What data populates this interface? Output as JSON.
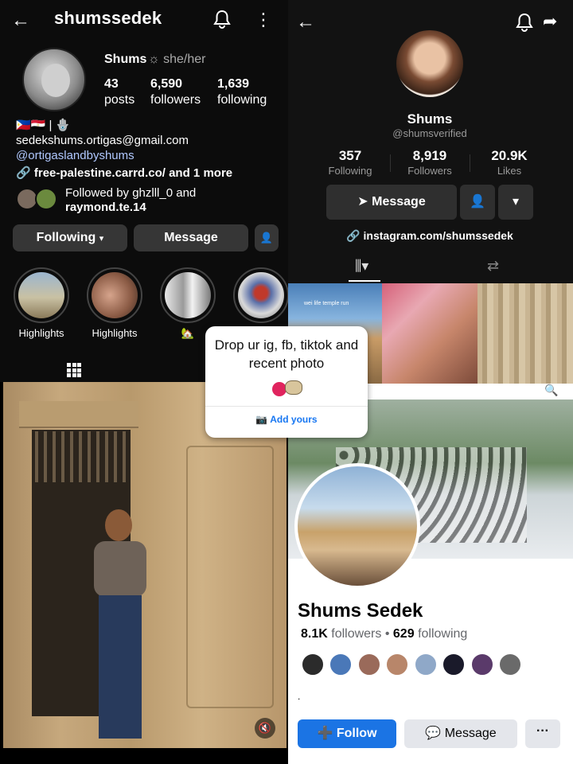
{
  "instagram": {
    "username": "shumssedek",
    "display_name": "Shums",
    "pronouns": "she/her",
    "stats": [
      {
        "number": "43",
        "label": "posts"
      },
      {
        "number": "6,590",
        "label": "followers"
      },
      {
        "number": "1,639",
        "label": "following"
      }
    ],
    "bio_flags": "🇵🇭🇪🇬 | 🪬",
    "email": "sedekshums.ortigas@gmail.com",
    "mention": "@ortigaslandbyshums",
    "link": "free-palestine.carrd.co/ and 1 more",
    "followed_by_line1": "Followed by ghzlll_0 and",
    "followed_by_line2": "raymond.te.14",
    "buttons": {
      "following": "Following",
      "message": "Message"
    },
    "highlights": [
      {
        "label": "Highlights"
      },
      {
        "label": "Highlights"
      },
      {
        "label": "🏡"
      },
      {
        "label": ""
      }
    ]
  },
  "tiktok": {
    "name": "Shums",
    "handle": "@shumsverified",
    "stats": [
      {
        "number": "357",
        "label": "Following"
      },
      {
        "number": "8,919",
        "label": "Followers"
      },
      {
        "number": "20.9K",
        "label": "Likes"
      }
    ],
    "message_label": "Message",
    "link": "instagram.com/shumssedek",
    "thumb_caption": "wei life temple run"
  },
  "sticker": {
    "prompt": "Drop ur ig, fb, tiktok and recent photo",
    "add_label": "Add yours"
  },
  "facebook": {
    "name": "Shums Sedek",
    "followers_count": "8.1K",
    "followers_label": "followers",
    "following_count": "629",
    "following_label": "following",
    "bullet": "•",
    "dot": ".",
    "follow_label": "Follow",
    "message_label": "Message",
    "more_label": "···"
  },
  "colors": {
    "ig_bg": "#0c0c0c",
    "tt_bg": "#121212",
    "fb_blue": "#1b74e4",
    "ig_link": "#b0c8ff"
  }
}
